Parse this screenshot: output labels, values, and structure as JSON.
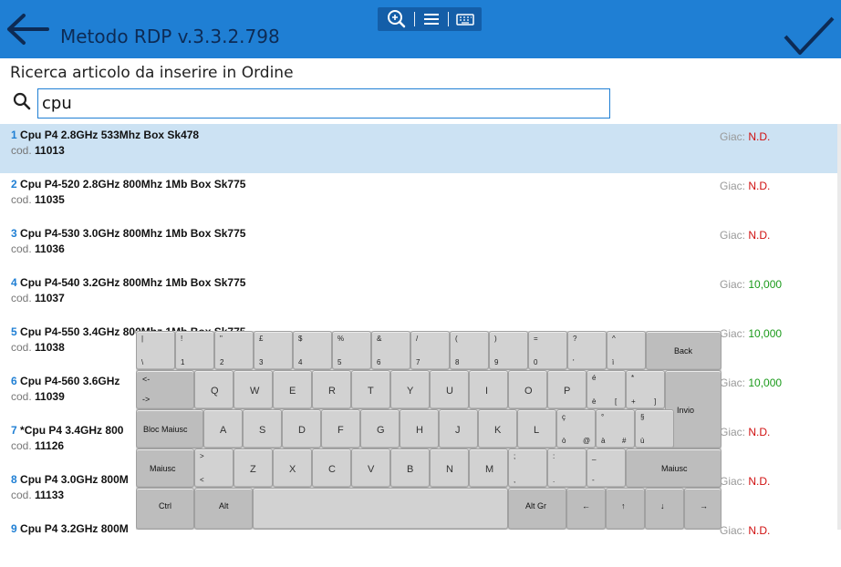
{
  "header": {
    "title": "Metodo RDP v.3.3.2.798",
    "color": "#1f7fd4"
  },
  "subtitle": "Ricerca articolo da inserire in Ordine",
  "search": {
    "value": "cpu",
    "placeholder": ""
  },
  "items": [
    {
      "num": "1",
      "name": "Cpu P4 2.8GHz 533Mhz Box Sk478",
      "code_label": "cod.",
      "code": "11013",
      "giac_label": "Giac:",
      "giac": "N.D.",
      "status": "nd"
    },
    {
      "num": "2",
      "name": "Cpu P4-520 2.8GHz 800Mhz 1Mb Box Sk775",
      "code_label": "cod.",
      "code": "11035",
      "giac_label": "Giac:",
      "giac": "N.D.",
      "status": "nd"
    },
    {
      "num": "3",
      "name": "Cpu P4-530 3.0GHz 800Mhz 1Mb Box Sk775",
      "code_label": "cod.",
      "code": "11036",
      "giac_label": "Giac:",
      "giac": "N.D.",
      "status": "nd"
    },
    {
      "num": "4",
      "name": "Cpu P4-540 3.2GHz 800Mhz 1Mb Box Sk775",
      "code_label": "cod.",
      "code": "11037",
      "giac_label": "Giac:",
      "giac": "10,000",
      "status": "ok"
    },
    {
      "num": "5",
      "name": "Cpu P4-550 3.4GHz 800Mhz 1Mb Box Sk775",
      "code_label": "cod.",
      "code": "11038",
      "giac_label": "Giac:",
      "giac": "10,000",
      "status": "ok"
    },
    {
      "num": "6",
      "name": "Cpu P4-560 3.6GHz",
      "code_label": "cod.",
      "code": "11039",
      "giac_label": "Giac:",
      "giac": "10,000",
      "status": "ok"
    },
    {
      "num": "7",
      "name": "*Cpu P4 3.4GHz 800",
      "code_label": "cod.",
      "code": "11126",
      "giac_label": "Giac:",
      "giac": "N.D.",
      "status": "nd"
    },
    {
      "num": "8",
      "name": "Cpu P4 3.0GHz 800M",
      "code_label": "cod.",
      "code": "11133",
      "giac_label": "Giac:",
      "giac": "N.D.",
      "status": "nd"
    },
    {
      "num": "9",
      "name": "Cpu P4 3.2GHz 800M",
      "code_label": "",
      "code": "",
      "giac_label": "Giac:",
      "giac": "N.D.",
      "status": "nd"
    }
  ],
  "keyboard": {
    "back": "Back",
    "invio": "Invio",
    "bloc_maiusc": "Bloc Maiusc",
    "maiusc": "Maiusc",
    "ctrl": "Ctrl",
    "alt": "Alt",
    "altgr": "Alt Gr",
    "tab_top": "<-",
    "tab_bottom": "->",
    "arrow_left": "←",
    "arrow_up": "↑",
    "arrow_down": "↓",
    "arrow_right": "→",
    "row1": [
      {
        "top": "|",
        "bottom": "\\"
      },
      {
        "top": "!",
        "bottom": "1"
      },
      {
        "top": "\"",
        "bottom": "2"
      },
      {
        "top": "£",
        "bottom": "3"
      },
      {
        "top": "$",
        "bottom": "4"
      },
      {
        "top": "%",
        "bottom": "5"
      },
      {
        "top": "&",
        "bottom": "6"
      },
      {
        "top": "/",
        "bottom": "7"
      },
      {
        "top": "(",
        "bottom": "8"
      },
      {
        "top": ")",
        "bottom": "9"
      },
      {
        "top": "=",
        "bottom": "0"
      },
      {
        "top": "?",
        "bottom": "'"
      },
      {
        "top": "^",
        "bottom": "ì"
      }
    ],
    "row2": [
      "Q",
      "W",
      "E",
      "R",
      "T",
      "Y",
      "U",
      "I",
      "O",
      "P"
    ],
    "row2_extra": [
      {
        "top": "é",
        "bottom": "è",
        "alt": "["
      },
      {
        "top": "*",
        "bottom": "+",
        "alt": "]"
      }
    ],
    "row3": [
      "A",
      "S",
      "D",
      "F",
      "G",
      "H",
      "J",
      "K",
      "L"
    ],
    "row3_extra": [
      {
        "top": "ç",
        "bottom": "ò",
        "alt": "@"
      },
      {
        "top": "°",
        "bottom": "à",
        "alt": "#"
      },
      {
        "top": "§",
        "bottom": "ù",
        "alt": ""
      }
    ],
    "row4_angle": {
      "top": ">",
      "bottom": "<"
    },
    "row4": [
      "Z",
      "X",
      "C",
      "V",
      "B",
      "N",
      "M"
    ],
    "row4_extra": [
      {
        "top": ";",
        "bottom": ","
      },
      {
        "top": ":",
        "bottom": "."
      },
      {
        "top": "_",
        "bottom": "-"
      }
    ]
  }
}
